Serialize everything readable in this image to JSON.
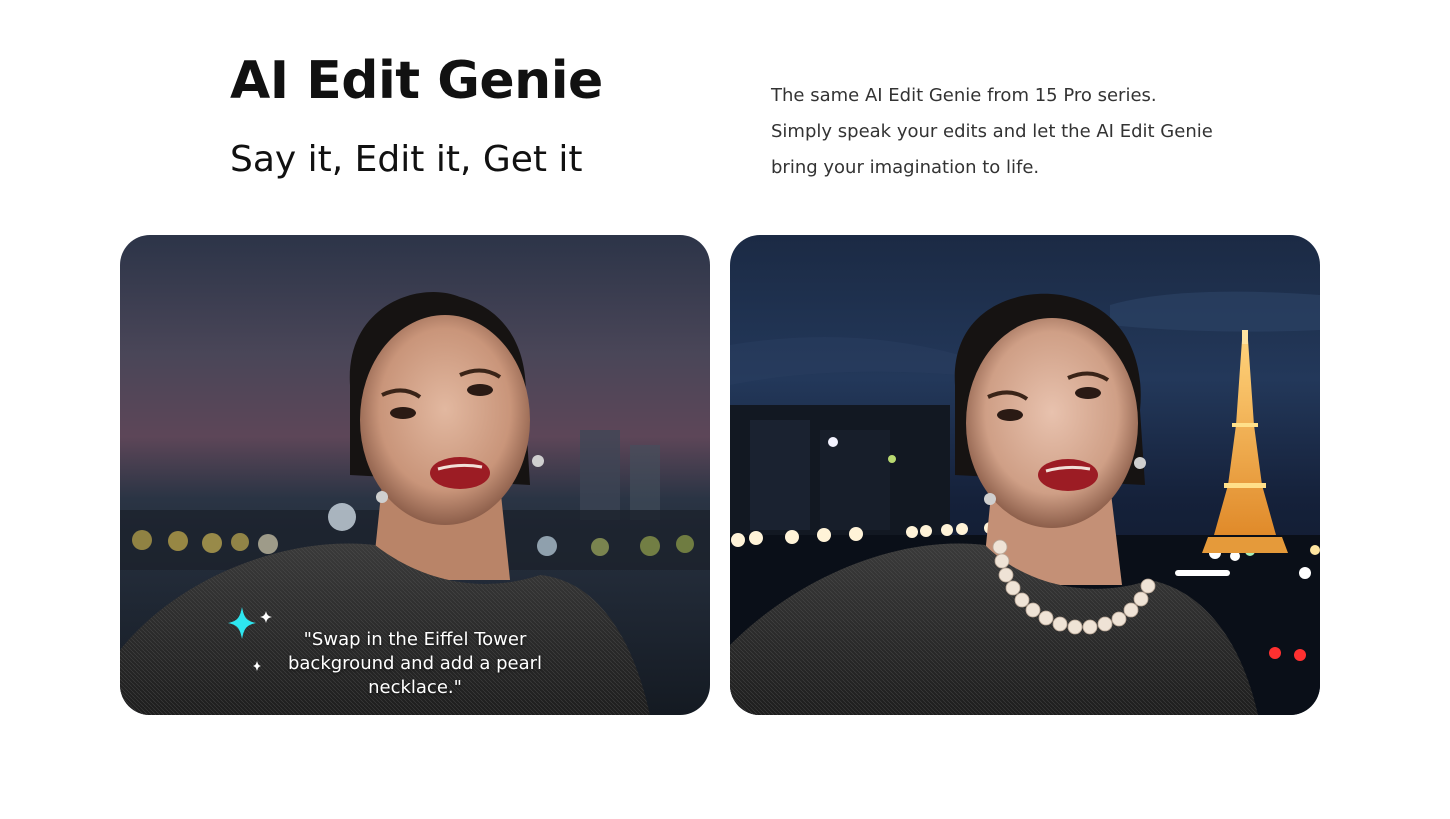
{
  "header": {
    "title": "AI Edit Genie",
    "subtitle": "Say it, Edit it, Get it",
    "description": "The same AI Edit Genie from 15 Pro series. Simply speak your edits and let the AI Edit Genie bring your imagination to life."
  },
  "before_card": {
    "prompt": "\"Swap in the Eiffel Tower background and add a pearl necklace.\"",
    "sparkle_icon": "sparkle-icon"
  },
  "after_card": {},
  "colors": {
    "text": "#111111",
    "sparkle": "#2ee6f0"
  }
}
